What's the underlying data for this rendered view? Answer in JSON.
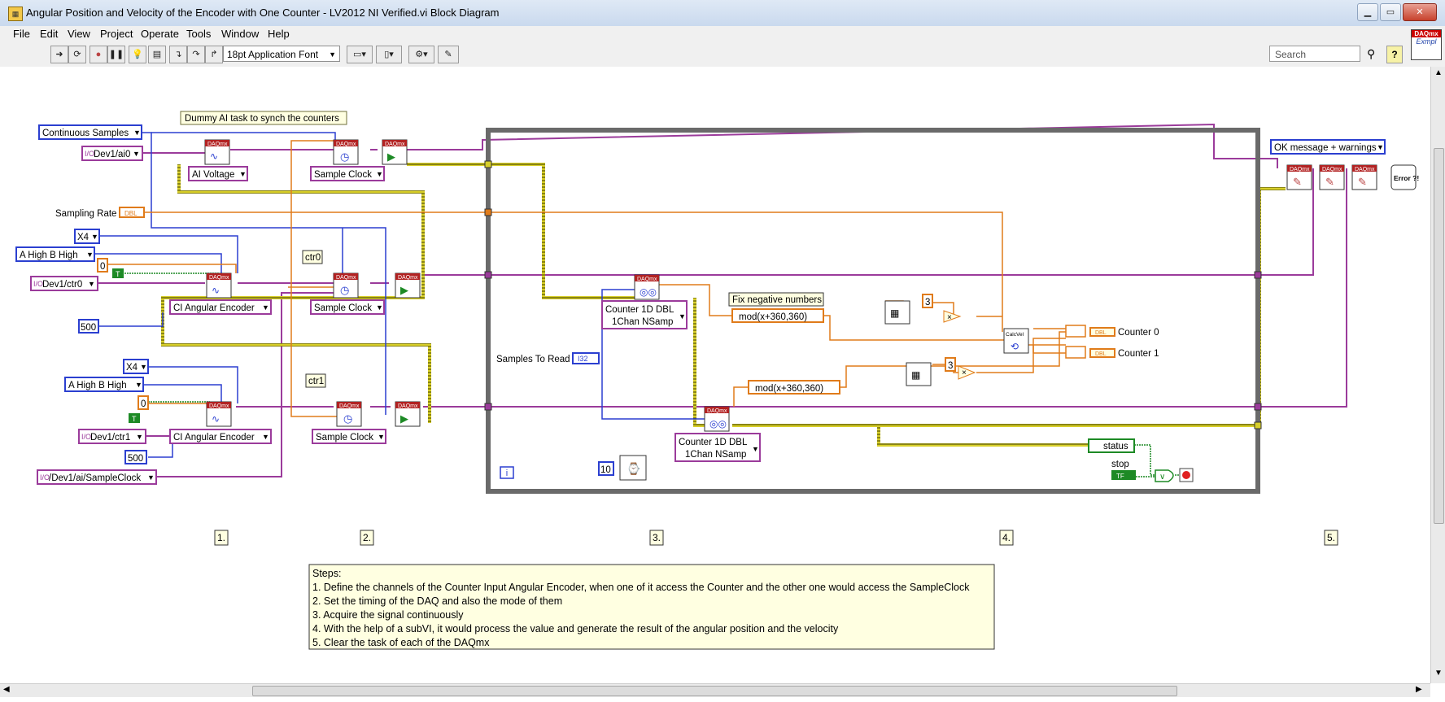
{
  "window": {
    "title": "Angular Position and Velocity of the Encoder with One Counter - LV2012 NI Verified.vi Block Diagram"
  },
  "menu": [
    "File",
    "Edit",
    "View",
    "Project",
    "Operate",
    "Tools",
    "Window",
    "Help"
  ],
  "toolbar": {
    "font": "18pt Application Font",
    "search_placeholder": "Search",
    "help": "?"
  },
  "vi_icon": {
    "header": "DAQmx",
    "body": "Exmpl"
  },
  "diagram": {
    "comment": "Dummy AI task to synch the counters",
    "constants": {
      "continuous": "Continuous Samples",
      "ai0": "Dev1/ai0",
      "ai_voltage": "AI Voltage",
      "sample_clock": "Sample Clock",
      "sampling_rate": "Sampling Rate",
      "x4": "X4",
      "ahbh": "A High B High",
      "zero": "0",
      "true": "T",
      "ctr0": "Dev1/ctr0",
      "ctr1": "Dev1/ctr1",
      "ci_angular": "CI Angular Encoder",
      "five_hundred": "500",
      "ctr0_label": "ctr0",
      "ctr1_label": "ctr1",
      "sampleclock_term": "/Dev1/ai/SampleClock",
      "dbl": "DBL",
      "ok_message": "OK message + warnings",
      "error": "Error ?!"
    },
    "loop": {
      "samples_to_read": "Samples To Read",
      "i32": "I32",
      "counter_read": [
        "Counter 1D DBL",
        "1Chan NSamp"
      ],
      "fix_negative": "Fix negative numbers",
      "mod_expr": "mod(x+360,360)",
      "three": "3",
      "calcvel": "CalcVel",
      "counter0": "Counter 0",
      "counter1": "Counter 1",
      "status": "status",
      "stop": "stop",
      "tf": "TF",
      "ten": "10",
      "iter": "i"
    },
    "steps_markers": [
      "1.",
      "2.",
      "3.",
      "4.",
      "5."
    ],
    "daqmx": "DAQmx",
    "steps_box": [
      "Steps:",
      "1. Define the channels of the Counter Input Angular Encoder, when one of it access the Counter and the other one would access the SampleClock",
      "2. Set the timing of the DAQ and also the mode of them",
      "3. Acquire the signal continuously",
      "4. With the help of a subVI, it would process the value and generate the result of the angular position and the velocity",
      "5. Clear the task of each of the DAQmx"
    ]
  }
}
